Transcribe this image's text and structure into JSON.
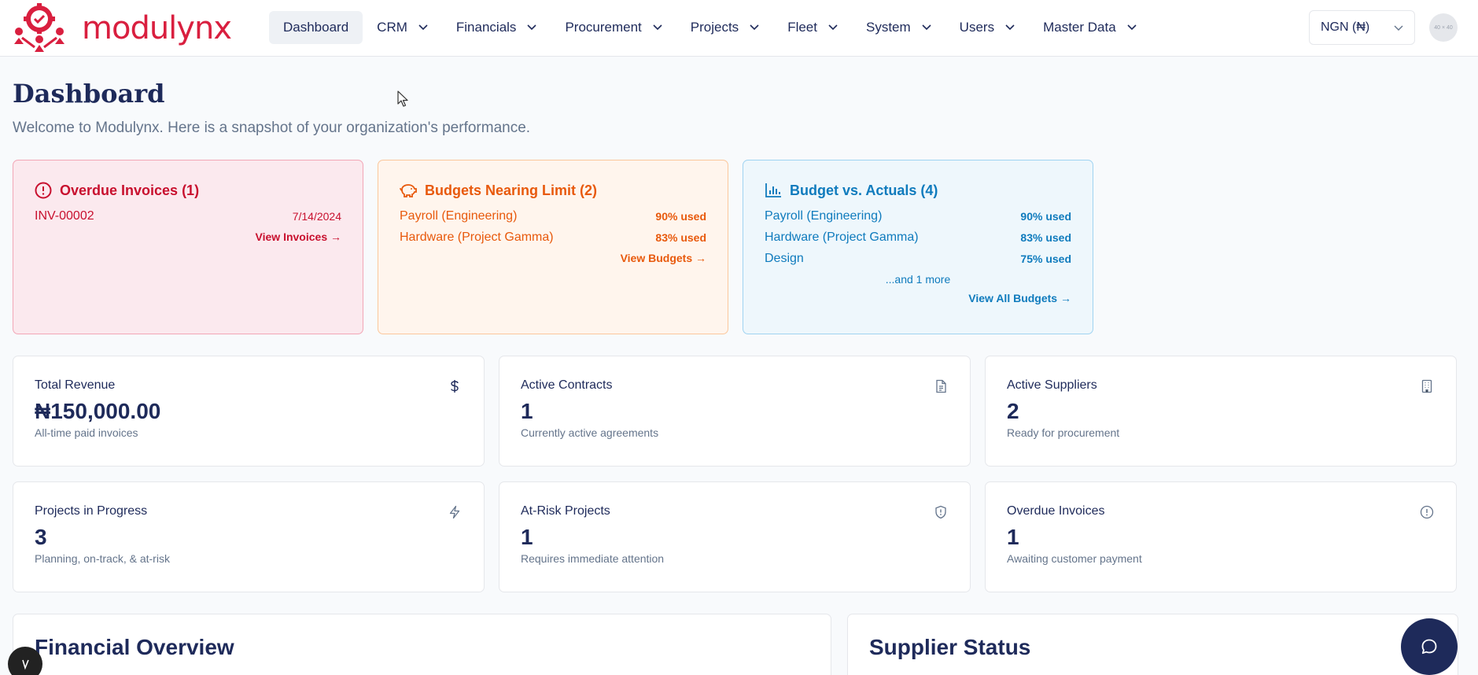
{
  "app": {
    "brand": "modulynx",
    "brand_color": "#d91f3f",
    "primary_color": "#1e2a5a"
  },
  "nav": {
    "items": [
      {
        "label": "Dashboard",
        "active": true,
        "has_dropdown": false
      },
      {
        "label": "CRM",
        "active": false,
        "has_dropdown": true
      },
      {
        "label": "Financials",
        "active": false,
        "has_dropdown": true
      },
      {
        "label": "Procurement",
        "active": false,
        "has_dropdown": true
      },
      {
        "label": "Projects",
        "active": false,
        "has_dropdown": true
      },
      {
        "label": "Fleet",
        "active": false,
        "has_dropdown": true
      },
      {
        "label": "System",
        "active": false,
        "has_dropdown": true
      },
      {
        "label": "Users",
        "active": false,
        "has_dropdown": true
      },
      {
        "label": "Master Data",
        "active": false,
        "has_dropdown": true
      }
    ],
    "currency": "NGN (₦)",
    "avatar_text": "40 × 40"
  },
  "page": {
    "title": "Dashboard",
    "subtitle": "Welcome to Modulynx. Here is a snapshot of your organization's performance."
  },
  "alerts": {
    "overdue": {
      "title": "Overdue Invoices (1)",
      "icon": "alert-circle-icon",
      "color": "#c8102e",
      "rows": [
        {
          "label": "INV-00002",
          "value": "7/14/2024"
        }
      ],
      "link": "View Invoices →"
    },
    "budgets": {
      "title": "Budgets Nearing Limit (2)",
      "icon": "piggy-bank-icon",
      "color": "#e8590c",
      "rows": [
        {
          "label": "Payroll (Engineering)",
          "value": "90% used"
        },
        {
          "label": "Hardware (Project Gamma)",
          "value": "83% used"
        }
      ],
      "link": "View Budgets →"
    },
    "actuals": {
      "title": "Budget vs. Actuals (4)",
      "icon": "bar-chart-icon",
      "color": "#0f7bbd",
      "rows": [
        {
          "label": "Payroll (Engineering)",
          "value": "90% used"
        },
        {
          "label": "Hardware (Project Gamma)",
          "value": "83% used"
        },
        {
          "label": "Design",
          "value": "75% used"
        }
      ],
      "more": "...and 1 more",
      "link": "View All Budgets →"
    }
  },
  "stats": [
    {
      "title": "Total Revenue",
      "value": "₦150,000.00",
      "note": "All-time paid invoices",
      "icon": "dollar-icon"
    },
    {
      "title": "Active Contracts",
      "value": "1",
      "note": "Currently active agreements",
      "icon": "document-icon"
    },
    {
      "title": "Active Suppliers",
      "value": "2",
      "note": "Ready for procurement",
      "icon": "building-icon"
    },
    {
      "title": "Projects in Progress",
      "value": "3",
      "note": "Planning, on-track, & at-risk",
      "icon": "lightning-icon"
    },
    {
      "title": "At-Risk Projects",
      "value": "1",
      "note": "Requires immediate attention",
      "icon": "shield-icon"
    },
    {
      "title": "Overdue Invoices",
      "value": "1",
      "note": "Awaiting customer payment",
      "icon": "alert-circle-icon"
    }
  ],
  "panels": {
    "financial": "Financial Overview",
    "supplier": "Supplier Status"
  }
}
